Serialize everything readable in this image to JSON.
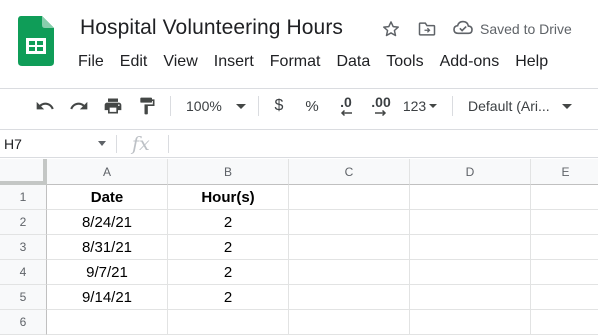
{
  "app": {
    "title": "Hospital Volunteering Hours",
    "saved_status": "Saved to Drive",
    "brand_color": "#0f9d58"
  },
  "title_icons": [
    "star-icon",
    "move-to-folder-icon",
    "cloud-saved-icon"
  ],
  "menu": [
    "File",
    "Edit",
    "View",
    "Insert",
    "Format",
    "Data",
    "Tools",
    "Add-ons",
    "Help"
  ],
  "toolbar": {
    "zoom": "100%",
    "currency": "$",
    "percent": "%",
    "decrease_decimal": ".0",
    "increase_decimal": ".00",
    "more_formats": "123",
    "font": "Default (Ari..."
  },
  "formula_bar": {
    "name_box": "H7",
    "fx": "fx",
    "value": ""
  },
  "grid": {
    "columns": [
      "A",
      "B",
      "C",
      "D",
      "E"
    ],
    "rows": [
      "1",
      "2",
      "3",
      "4",
      "5",
      "6"
    ],
    "cells": [
      [
        "Date",
        "Hour(s)",
        "",
        "",
        ""
      ],
      [
        "8/24/21",
        "2",
        "",
        "",
        ""
      ],
      [
        "8/31/21",
        "2",
        "",
        "",
        ""
      ],
      [
        "9/7/21",
        "2",
        "",
        "",
        ""
      ],
      [
        "9/14/21",
        "2",
        "",
        "",
        ""
      ],
      [
        "",
        "",
        "",
        "",
        ""
      ]
    ]
  }
}
